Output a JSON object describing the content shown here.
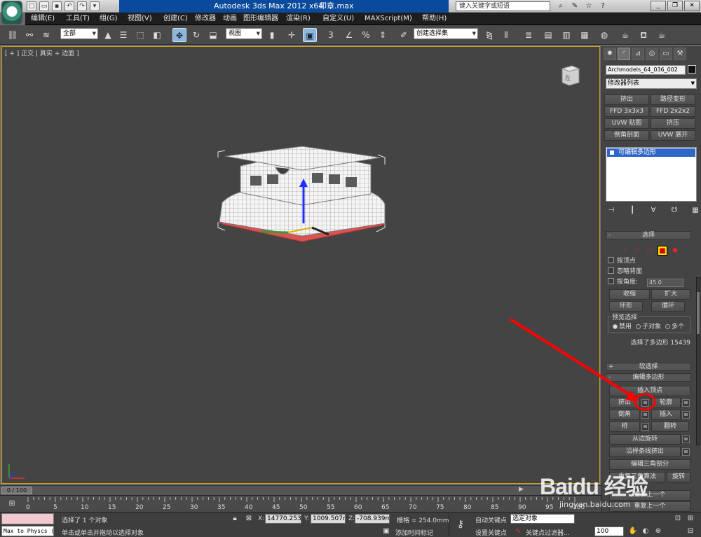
{
  "title_bar": {
    "app_name": "Autodesk 3ds Max  2012 x64",
    "file_name": "印章.max",
    "search_placeholder": "键入关键字或短语",
    "qat_icons": [
      "new-icon",
      "open-icon",
      "save-icon",
      "undo-icon",
      "redo-icon",
      "dropdown-icon"
    ]
  },
  "menu": [
    "编辑(E)",
    "工具(T)",
    "组(G)",
    "视图(V)",
    "创建(C)",
    "修改器",
    "动画",
    "图形编辑器",
    "渲染(R)",
    "自定义(U)",
    "MAXScript(M)",
    "帮助(H)"
  ],
  "toolbar": {
    "selection_filter": "全部",
    "ref_coord": "视图",
    "named_selection": "创建选择集",
    "snap_value": "3"
  },
  "viewport": {
    "label": "[ + ] 正交 | 真实 + 边面 ]",
    "viewcube_label": "左"
  },
  "command_panel": {
    "object_name": "Archmodels_64_036_002",
    "modifier_list": "修改器列表",
    "modifier_buttons": [
      [
        "挤出",
        "路径变形"
      ],
      [
        "FFD 3x3x3",
        "FFD 2x2x2"
      ],
      [
        "UVW 贴图",
        "挤压"
      ],
      [
        "倒角剖面",
        "UVW 展开"
      ]
    ],
    "stack_item": "可编辑多边形",
    "selection": {
      "header": "选择",
      "by_vertex": "按顶点",
      "ignore_backfacing": "忽略背面",
      "by_angle": "按角度:",
      "angle_value": "45.0",
      "shrink": "收缩",
      "grow": "扩大",
      "ring": "环形",
      "loop": "循环",
      "preview_label": "预览选择",
      "preview_options": [
        "禁用",
        "子对象",
        "多个"
      ],
      "status": "选择了多边形 15439"
    },
    "soft_selection": "软选择",
    "edit_polygons": {
      "header": "编辑多边形",
      "insert_vertex": "插入顶点",
      "extrude": "挤出",
      "outline": "轮廓",
      "bevel": "倒角",
      "inset": "插入",
      "bridge": "桥",
      "flip": "翻转",
      "hinge": "从边旋转",
      "extrude_along_spline": "沿样条线挤出",
      "edit_triangulation": "编辑三角剖分",
      "retriangulate": "重复三角算法",
      "turn": "旋转"
    },
    "extra_header_1": "重复上一个",
    "extra_header_2": "重复上一个"
  },
  "timeline": {
    "slider": "0 / 100",
    "ticks": [
      "0",
      "5",
      "10",
      "15",
      "20",
      "25",
      "30",
      "35",
      "40",
      "45",
      "50",
      "55",
      "60",
      "65",
      "70",
      "75",
      "80",
      "85",
      "90",
      "95",
      "100"
    ]
  },
  "status_bar": {
    "maxscript_text": "Max to Physcs (",
    "selected": "选择了 1 个对象",
    "prompt": "单击或单击并拖动以选择对象",
    "x_value": "14770.253",
    "y_value": "1009.507m",
    "z_value": "-708.939m",
    "grid": "栅格 = 254.0mm",
    "add_time_tag": "添加时间标记",
    "auto_key": "自动关键点",
    "set_key": "设置关键点",
    "key_mode": "选定对象",
    "key_filters": "关键点过滤器...",
    "frame": "100"
  },
  "watermark": {
    "brand": "Baidu 经验",
    "url": "jingyan.baidu.com"
  },
  "colors": {
    "viewport_bg": "#444444",
    "selection_face": "#d9534f",
    "active_border": "#d4a017",
    "stack_highlight": "#2f66c7",
    "annotation": "#ff0000"
  }
}
